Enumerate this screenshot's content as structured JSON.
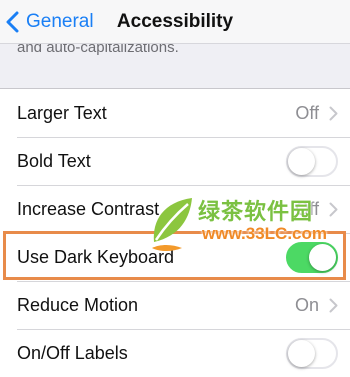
{
  "navbar": {
    "back_label": "General",
    "title": "Accessibility"
  },
  "section_footer_note": "and auto-capitalizations.",
  "settings": [
    {
      "label": "Larger Text",
      "value": "Off",
      "control": "disclosure"
    },
    {
      "label": "Bold Text",
      "control": "switch",
      "on": false
    },
    {
      "label": "Increase Contrast",
      "value": "Off",
      "control": "disclosure"
    },
    {
      "label": "Use Dark Keyboard",
      "control": "switch",
      "on": true,
      "highlighted": true
    },
    {
      "label": "Reduce Motion",
      "value": "On",
      "control": "disclosure"
    },
    {
      "label": "On/Off Labels",
      "control": "switch",
      "on": false
    }
  ],
  "watermark": {
    "title": "绿茶软件园",
    "url": "www.33LC.com"
  },
  "colors": {
    "ios_blue": "#1a7ff5",
    "switch_on_green": "#4cd964",
    "highlight_orange": "#e88b4a",
    "watermark_green": "#7bc142",
    "watermark_orange": "#f08a28"
  }
}
